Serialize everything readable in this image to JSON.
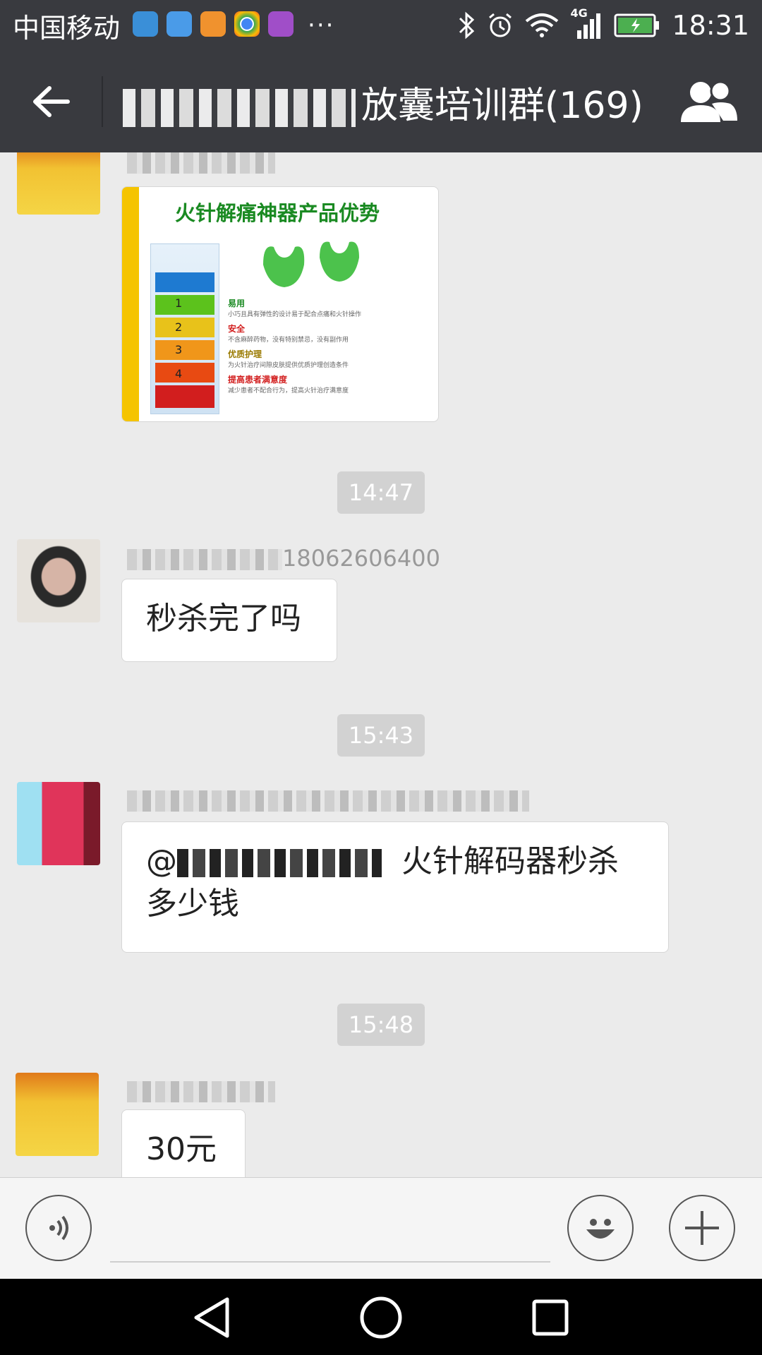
{
  "status_bar": {
    "carrier": "中国移动",
    "more": "···",
    "network": "4G",
    "time": "18:31"
  },
  "header": {
    "title_suffix": "放囊培训群(169)"
  },
  "messages": {
    "image_card": {
      "title": "火针解痛神器产品优势",
      "features": [
        {
          "heading": "易用",
          "desc": "小巧且具有弹性的设计易于配合点痛和火针操作"
        },
        {
          "heading": "安全",
          "desc": "不含麻醉药物，没有特别禁忌，没有副作用"
        },
        {
          "heading": "优质护理",
          "desc": "为火针治疗间隙皮肤提供优质护理创造条件"
        },
        {
          "heading": "提高患者满意度",
          "desc": "减少患者不配合行为，提高火针治疗满意度"
        }
      ],
      "steps": [
        "1",
        "2",
        "3",
        "4"
      ]
    },
    "ts1": "14:47",
    "msg1": {
      "sender_visible": "18062606400",
      "text": "秒杀完了吗"
    },
    "ts2": "15:43",
    "msg2": {
      "mention": "@",
      "text_line1": "火针解码器秒杀",
      "text_line2": "多少钱"
    },
    "ts3": "15:48",
    "msg3": {
      "text": "30元"
    }
  },
  "input": {
    "placeholder": ""
  },
  "colors": {
    "bar_bg": "#393a3f",
    "chat_bg": "#ebebeb",
    "timestamp_bg": "#d2d2d2",
    "battery_green": "#4caf50"
  }
}
